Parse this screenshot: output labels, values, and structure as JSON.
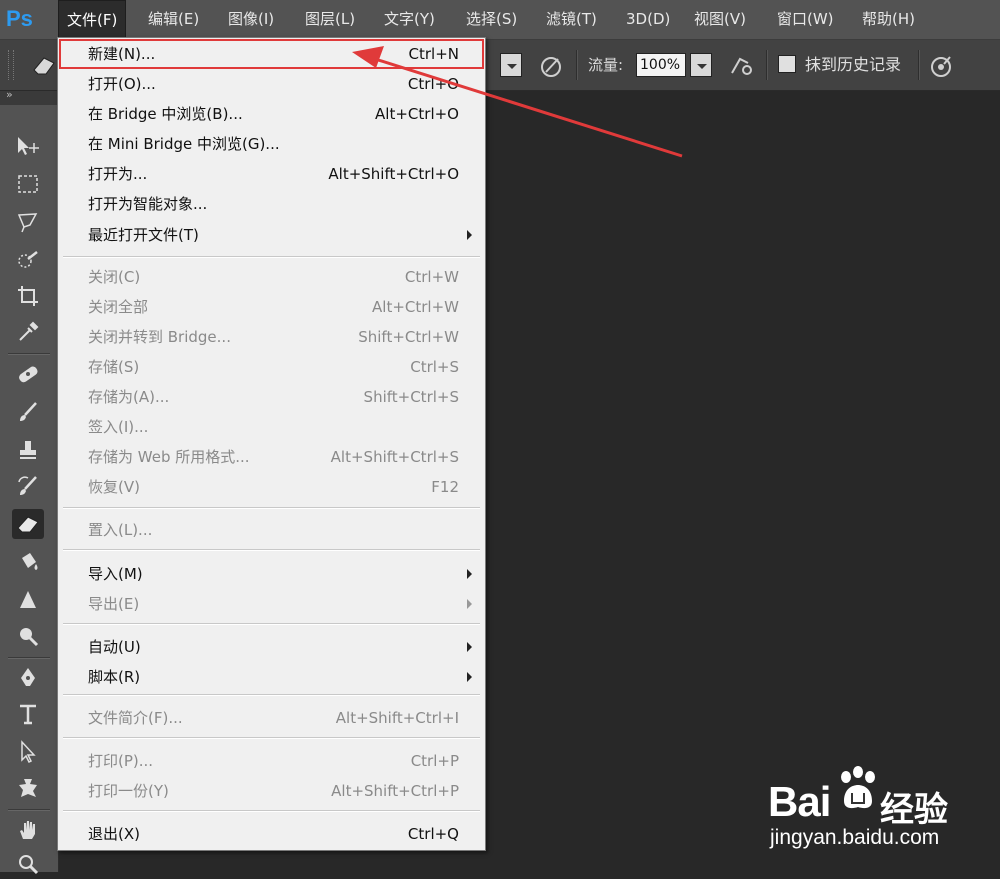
{
  "app": {
    "logo": "Ps"
  },
  "menubar": {
    "items": [
      "文件(F)",
      "编辑(E)",
      "图像(I)",
      "图层(L)",
      "文字(Y)",
      "选择(S)",
      "滤镜(T)",
      "3D(D)",
      "视图(V)",
      "窗口(W)",
      "帮助(H)"
    ],
    "active_index": 0
  },
  "options_bar": {
    "flow_label": "流量:",
    "flow_value": "100%",
    "history_checkbox_label": "抹到历史记录",
    "history_checked": false
  },
  "file_menu": {
    "items": [
      {
        "label": "新建(N)...",
        "shortcut": "Ctrl+N",
        "enabled": true,
        "submenu": false,
        "highlighted": true
      },
      {
        "label": "打开(O)...",
        "shortcut": "Ctrl+O",
        "enabled": true,
        "submenu": false
      },
      {
        "label": "在 Bridge 中浏览(B)...",
        "shortcut": "Alt+Ctrl+O",
        "enabled": true,
        "submenu": false
      },
      {
        "label": "在 Mini Bridge 中浏览(G)...",
        "shortcut": "",
        "enabled": true,
        "submenu": false
      },
      {
        "label": "打开为...",
        "shortcut": "Alt+Shift+Ctrl+O",
        "enabled": true,
        "submenu": false
      },
      {
        "label": "打开为智能对象...",
        "shortcut": "",
        "enabled": true,
        "submenu": false
      },
      {
        "label": "最近打开文件(T)",
        "shortcut": "",
        "enabled": true,
        "submenu": true
      },
      {
        "label": "关闭(C)",
        "shortcut": "Ctrl+W",
        "enabled": false,
        "submenu": false
      },
      {
        "label": "关闭全部",
        "shortcut": "Alt+Ctrl+W",
        "enabled": false,
        "submenu": false
      },
      {
        "label": "关闭并转到 Bridge...",
        "shortcut": "Shift+Ctrl+W",
        "enabled": false,
        "submenu": false
      },
      {
        "label": "存储(S)",
        "shortcut": "Ctrl+S",
        "enabled": false,
        "submenu": false
      },
      {
        "label": "存储为(A)...",
        "shortcut": "Shift+Ctrl+S",
        "enabled": false,
        "submenu": false
      },
      {
        "label": "签入(I)...",
        "shortcut": "",
        "enabled": false,
        "submenu": false
      },
      {
        "label": "存储为 Web 所用格式...",
        "shortcut": "Alt+Shift+Ctrl+S",
        "enabled": false,
        "submenu": false
      },
      {
        "label": "恢复(V)",
        "shortcut": "F12",
        "enabled": false,
        "submenu": false
      },
      {
        "label": "置入(L)...",
        "shortcut": "",
        "enabled": false,
        "submenu": false
      },
      {
        "label": "导入(M)",
        "shortcut": "",
        "enabled": true,
        "submenu": true
      },
      {
        "label": "导出(E)",
        "shortcut": "",
        "enabled": false,
        "submenu": true
      },
      {
        "label": "自动(U)",
        "shortcut": "",
        "enabled": true,
        "submenu": true
      },
      {
        "label": "脚本(R)",
        "shortcut": "",
        "enabled": true,
        "submenu": true
      },
      {
        "label": "文件简介(F)...",
        "shortcut": "Alt+Shift+Ctrl+I",
        "enabled": false,
        "submenu": false
      },
      {
        "label": "打印(P)...",
        "shortcut": "Ctrl+P",
        "enabled": false,
        "submenu": false
      },
      {
        "label": "打印一份(Y)",
        "shortcut": "Alt+Shift+Ctrl+P",
        "enabled": false,
        "submenu": false
      },
      {
        "label": "退出(X)",
        "shortcut": "Ctrl+Q",
        "enabled": true,
        "submenu": false
      }
    ]
  },
  "toolbar": {
    "tools": [
      "move-icon",
      "marquee-icon",
      "lasso-icon",
      "quick-select-icon",
      "crop-icon",
      "eyedropper-icon",
      "healing-brush-icon",
      "brush-icon",
      "clone-stamp-icon",
      "history-brush-icon",
      "eraser-icon",
      "paint-bucket-icon",
      "blur-icon",
      "dodge-icon",
      "pen-icon",
      "type-icon",
      "path-select-icon",
      "shape-icon",
      "hand-icon",
      "zoom-icon"
    ],
    "selected_tool": "eraser-icon"
  },
  "watermark": {
    "brand": "Bai",
    "brand_cn": "经验",
    "url": "jingyan.baidu.com"
  },
  "colors": {
    "annotation": "#e03a3a",
    "ps_blue": "#2d9bf0"
  }
}
